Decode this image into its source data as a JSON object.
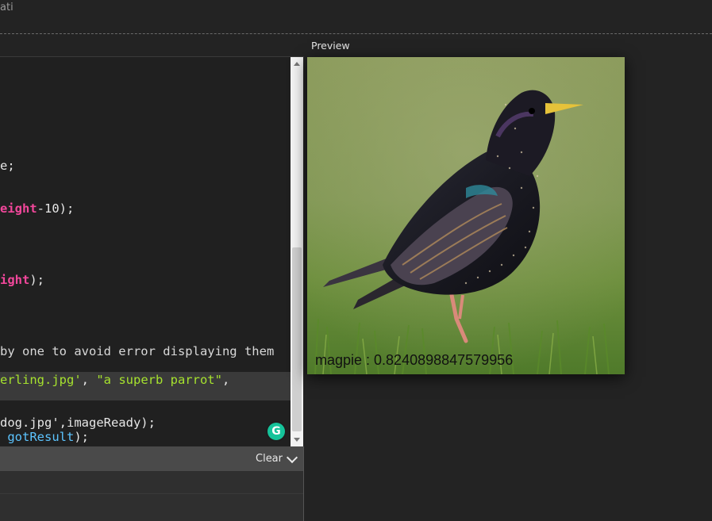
{
  "app": {
    "title_fragment": "ati"
  },
  "editor": {
    "lines": {
      "l1": "e;",
      "l2a": "eight",
      "l2b": "-10);",
      "l3a": "ight",
      "l3b": ");",
      "l4": "by one to avoid error displaying them",
      "l5a": "erling.jpg'",
      "l5b": ", ",
      "l5c": "\"a superb parrot\"",
      "l5d": ",",
      "l6": "dog.jpg',imageReady);",
      "l7a": " ",
      "l7b": "gotResult",
      "l7c": ");"
    }
  },
  "console": {
    "clear_label": "Clear"
  },
  "preview": {
    "label": "Preview",
    "prediction": "magpie : 0.8240898847579956"
  },
  "colors": {
    "keyword_pink": "#f2479b",
    "string_green": "#a6e22e",
    "function_blue": "#5cc4ff",
    "grammarly_green": "#15c39a"
  },
  "icons": {
    "grammarly": "grammarly-icon",
    "chevron": "chevron-down-icon"
  }
}
